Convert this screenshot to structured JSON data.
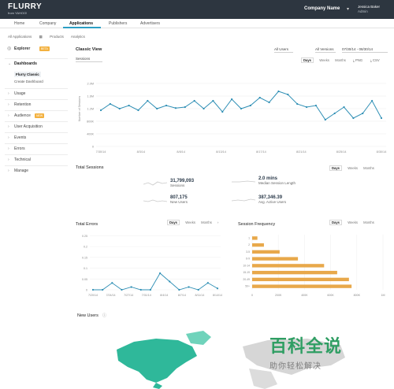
{
  "header": {
    "logo_text": "FLURRY",
    "logo_sub": "from YAHOO!",
    "company": "Company Name",
    "user_name": "Jessica Baker",
    "user_role": "Admin"
  },
  "nav": {
    "tabs": [
      "Home",
      "Company",
      "Applications",
      "Publishers",
      "Advertisers"
    ],
    "active": "Applications"
  },
  "breadcrumb": [
    "All Applications",
    "Products",
    "Analytics"
  ],
  "sidebar": {
    "explorer": "Explorer",
    "explorer_badge": "BETA",
    "dashboards": "Dashboards",
    "sub_items": [
      "Flurry Classic",
      "Create Dashboard"
    ],
    "items": [
      "Usage",
      "Retention",
      "Audience",
      "User Acquisition",
      "Events",
      "Errors",
      "Technical",
      "Manage"
    ],
    "audience_badge": "NEW"
  },
  "classic": {
    "title": "Classic View",
    "metric_select": "Sessions",
    "filter1": "All Users",
    "filter2": "All Versions",
    "daterange": "07/30/14 - 08/30/14",
    "periods": [
      "Days",
      "Weeks",
      "Months"
    ],
    "actions": [
      "PNG",
      "CSV"
    ]
  },
  "total_sessions": {
    "title": "Total Sessions",
    "periods": [
      "Days",
      "Weeks",
      "Months"
    ],
    "kpis": [
      {
        "value": "31,799,093",
        "label": "Sessions"
      },
      {
        "value": "2.0 mins",
        "label": "Median Session Length"
      },
      {
        "value": "807,175",
        "label": "New Users"
      },
      {
        "value": "387,346.39",
        "label": "Avg. Active Users"
      }
    ]
  },
  "total_errors": {
    "title": "Total Errors",
    "periods": [
      "Days",
      "Weeks",
      "Months"
    ]
  },
  "session_frequency": {
    "title": "Session Frequency",
    "periods": [
      "Days",
      "Weeks",
      "Months"
    ]
  },
  "new_users": {
    "title": "New Users"
  },
  "watermark": {
    "main": "百科全说",
    "sub": "助你轻松解决"
  },
  "colors": {
    "accent": "#2b9ec4",
    "line": "#2f8fb5",
    "bars": "#e8a84a",
    "map": "#2fb89a",
    "topbar": "#2d3640"
  },
  "chart_data": [
    {
      "type": "line",
      "title": "Classic View",
      "ylabel": "Number of Sessions",
      "ylim": [
        0,
        2.4
      ],
      "y_ticks": [
        "0",
        "400K",
        "800K",
        "1.2M",
        "1.6M",
        "2.0M"
      ],
      "x_ticks": [
        "7/30/14",
        "8/3/14",
        "8/8/14",
        "8/13/14",
        "8/17/14",
        "8/21/14",
        "8/25/14",
        "8/30/14"
      ],
      "series": [
        {
          "values": [
            1.15,
            1.35,
            1.2,
            1.3,
            1.15,
            1.45,
            1.2,
            1.3,
            1.22,
            1.25,
            1.45,
            1.2,
            1.45,
            1.1,
            1.5,
            1.2,
            1.3,
            1.55,
            1.4,
            1.75,
            1.65,
            1.35,
            1.25,
            1.3,
            0.85,
            1.05,
            1.25,
            0.9,
            1.05,
            1.45,
            0.9
          ]
        }
      ]
    },
    {
      "type": "line",
      "title": "Total Errors",
      "ylim": [
        0,
        0.4
      ],
      "y_ticks": [
        "0",
        "0.05",
        "0.1",
        "0.15",
        "0.2",
        "0.25"
      ],
      "x_ticks": [
        "7/20/14",
        "7/24/14",
        "7/27/14",
        "7/31/14",
        "8/4/14",
        "8/7/14",
        "8/11/14",
        "8/14/14"
      ],
      "series": [
        {
          "values": [
            0.0,
            0.0,
            0.05,
            0.0,
            0.02,
            0.0,
            0.0,
            0.12,
            0.06,
            0.0,
            0.02,
            0.0,
            0.05,
            0.01
          ]
        }
      ]
    },
    {
      "type": "bar",
      "title": "Session Frequency",
      "categories": [
        "1",
        "2",
        "3-5",
        "6-9",
        "10-14",
        "15-19",
        "20-49",
        "50+"
      ],
      "values": [
        40,
        90,
        210,
        350,
        550,
        650,
        740,
        760
      ],
      "x_ticks": [
        "0",
        "200K",
        "400K",
        "600K",
        "800K",
        "1M"
      ]
    }
  ]
}
